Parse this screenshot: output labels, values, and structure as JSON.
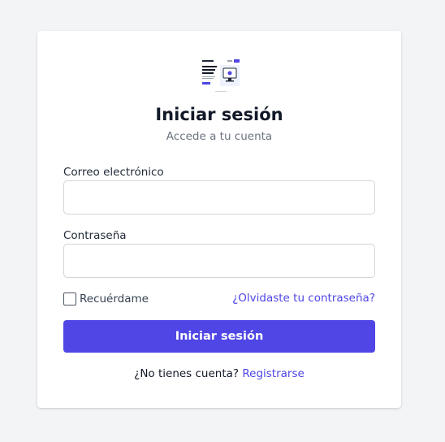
{
  "card": {
    "logo_icon": "app-screenshot-logo",
    "title": "Iniciar sesión",
    "subtitle": "Accede a tu cuenta"
  },
  "form": {
    "email_label": "Correo electrónico",
    "email_value": "",
    "password_label": "Contraseña",
    "password_value": "",
    "remember_label": "Recuérdame",
    "remember_checked": false,
    "forgot_link": "¿Olvidaste tu contraseña?",
    "submit_label": "Iniciar sesión"
  },
  "footer": {
    "prompt": "¿No tienes cuenta?",
    "register_link": "Registrarse"
  },
  "colors": {
    "background": "#f3f4f6",
    "accent": "#4f46e5",
    "card": "#ffffff"
  }
}
